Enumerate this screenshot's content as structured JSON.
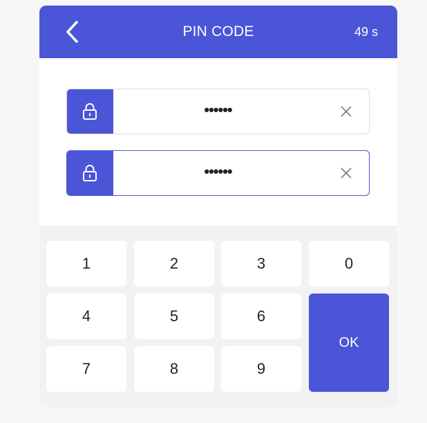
{
  "header": {
    "title": "PIN CODE",
    "countdown": "49 s",
    "back_icon": "chevron-left-icon"
  },
  "fields": [
    {
      "value": "••••••",
      "icon": "lock-icon",
      "clear_icon": "close-icon"
    },
    {
      "value": "••••••",
      "icon": "lock-icon",
      "clear_icon": "close-icon"
    }
  ],
  "keypad": {
    "keys": [
      "1",
      "2",
      "3",
      "0",
      "4",
      "5",
      "6",
      "7",
      "8",
      "9"
    ],
    "ok_label": "OK"
  },
  "colors": {
    "accent": "#4b55d8",
    "background": "#f7f7f7",
    "keypad_bg": "#f2f2f2"
  }
}
